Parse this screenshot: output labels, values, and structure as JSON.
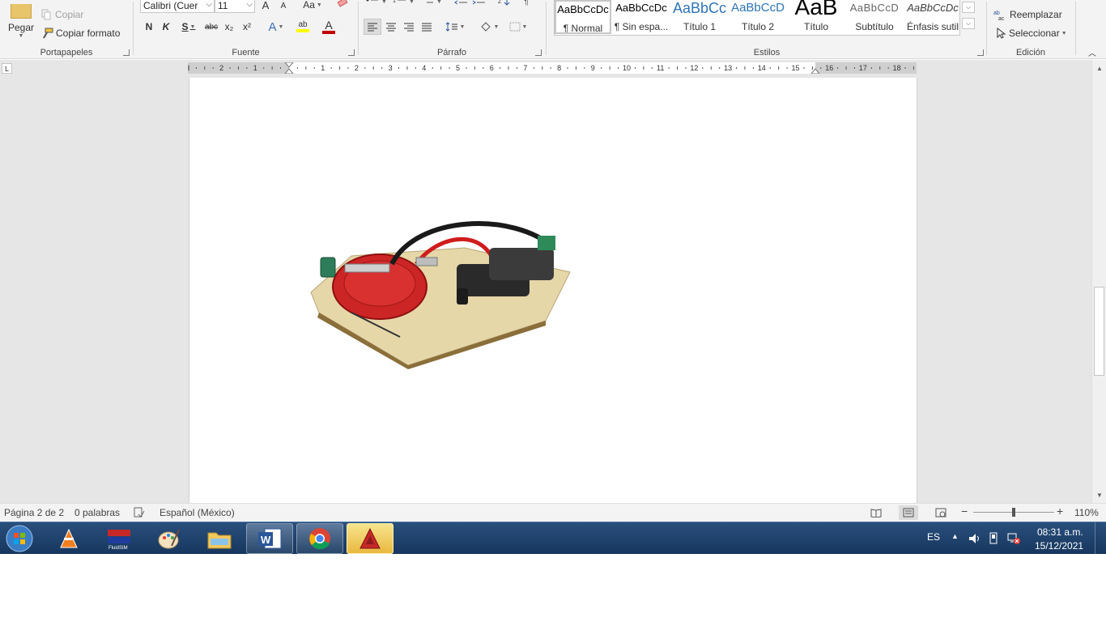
{
  "ribbon": {
    "clipboard": {
      "label": "Portapapeles",
      "paste_label": "Pegar",
      "copy_label": "Copiar",
      "format_painter_label": "Copiar formato"
    },
    "font": {
      "label": "Fuente",
      "font_name": "Calibri (Cuer",
      "font_size": "11",
      "bold": "N",
      "italic": "K",
      "underline": "S",
      "strikethrough": "abc",
      "subscript": "x₂",
      "superscript": "x²",
      "grow": "A",
      "shrink": "A",
      "change_case": "Aa",
      "text_effects": "A",
      "highlight": "ab",
      "font_color": "A"
    },
    "paragraph": {
      "label": "Párrafo"
    },
    "styles": {
      "label": "Estilos",
      "items": [
        {
          "sample": "AaBbCcDc",
          "name": "¶ Normal"
        },
        {
          "sample": "AaBbCcDc",
          "name": "¶ Sin espa..."
        },
        {
          "sample": "AaBbCc",
          "name": "Título 1"
        },
        {
          "sample": "AaBbCcD",
          "name": "Título 2"
        },
        {
          "sample": "AaB",
          "name": "Título"
        },
        {
          "sample": "AaBbCcD",
          "name": "Subtítulo"
        },
        {
          "sample": "AaBbCcDc",
          "name": "Énfasis sutil"
        }
      ]
    },
    "editing": {
      "label": "Edición",
      "replace_label": "Reemplazar",
      "select_label": "Seleccionar"
    }
  },
  "ruler": {
    "left_labels": [
      "3",
      "2",
      "1"
    ],
    "right_labels": [
      "1",
      "2",
      "3",
      "4",
      "5",
      "6",
      "7",
      "8",
      "9",
      "10",
      "11",
      "12",
      "13",
      "14",
      "15",
      "16",
      "17",
      "18"
    ],
    "tab_selector": "L"
  },
  "statusbar": {
    "page": "Página 2 de 2",
    "words": "0 palabras",
    "language": "Español (México)",
    "zoom": "110%"
  },
  "taskbar": {
    "lang": "ES",
    "time": "08:31 a.m.",
    "date": "15/12/2021",
    "apps": [
      "vlc-icon",
      "fluidsim-icon",
      "paint-icon",
      "explorer-icon",
      "word-icon",
      "chrome-icon",
      "autocad-icon"
    ]
  },
  "colors": {
    "word_blue": "#2b579a",
    "taskbar": "#1e4470",
    "font_color_red": "#c00000",
    "highlight_yellow": "#ffff00",
    "active_app": "#e9b83f"
  }
}
